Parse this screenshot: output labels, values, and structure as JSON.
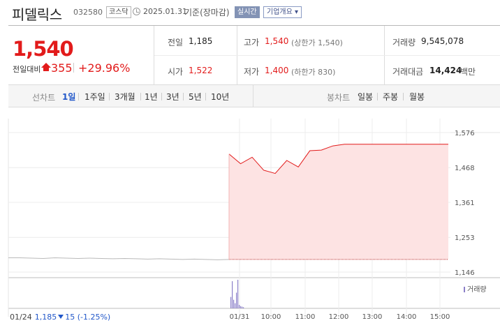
{
  "header": {
    "stock_name": "피델릭스",
    "stock_code": "032580",
    "market": "코스닥",
    "date": "2025.01.31",
    "basis": "기준(장마감)",
    "realtime_label": "실시간",
    "company_overview_label": "기업개요"
  },
  "summary": {
    "current_price": "1,540",
    "change_label": "전일대비",
    "change_value": "355",
    "change_rate": "+29.96%",
    "prev_close_label": "전일",
    "prev_close": "1,185",
    "open_label": "시가",
    "open": "1,522",
    "high_label": "고가",
    "high": "1,540",
    "upper_limit": "(상한가 1,540)",
    "low_label": "저가",
    "low": "1,400",
    "lower_limit": "(하한가 830)",
    "volume_label": "거래량",
    "volume": "9,545,078",
    "trade_value_label": "거래대금",
    "trade_value": "14,424",
    "trade_value_unit": "백만"
  },
  "period_tabs": {
    "label": "선차트",
    "items": [
      "1일",
      "1주일",
      "3개월",
      "1년",
      "3년",
      "5년",
      "10년"
    ],
    "selected": "1일"
  },
  "candle_tabs": {
    "label": "봉차트",
    "items": [
      "일봉",
      "주봉",
      "월봉"
    ]
  },
  "colors": {
    "up": "#e21b1b",
    "down": "#2157c9",
    "volume": "#8b7fc9"
  },
  "chart_data": {
    "type": "line",
    "y_ticks": [
      "1,576",
      "1,468",
      "1,361",
      "1,253",
      "1,146"
    ],
    "ylim": [
      1146,
      1576
    ],
    "x_ticks": [
      "01/24",
      "01/31",
      "10:00",
      "11:00",
      "12:00",
      "13:00",
      "14:00",
      "15:00"
    ],
    "prev_day": {
      "date": "01/24",
      "close": 1185,
      "values": [
        1190,
        1190,
        1189,
        1188,
        1190,
        1189,
        1188,
        1189,
        1188,
        1187,
        1188,
        1187,
        1186,
        1187,
        1186,
        1185,
        1186,
        1185,
        1184,
        1185
      ]
    },
    "today": {
      "date": "01/31",
      "prev_close_line": 1185,
      "values": [
        1510,
        1480,
        1500,
        1460,
        1450,
        1490,
        1470,
        1520,
        1522,
        1535,
        1540,
        1540,
        1540,
        1540,
        1540,
        1540,
        1540,
        1540,
        1540,
        1540
      ]
    },
    "volume_legend": "거래량",
    "volume_bars": [
      40,
      95,
      30,
      18,
      55,
      100,
      12,
      8,
      6,
      4
    ],
    "prev_info": {
      "date": "01/24",
      "close": "1,185",
      "change": "15",
      "rate": "(-1.25%)"
    }
  }
}
